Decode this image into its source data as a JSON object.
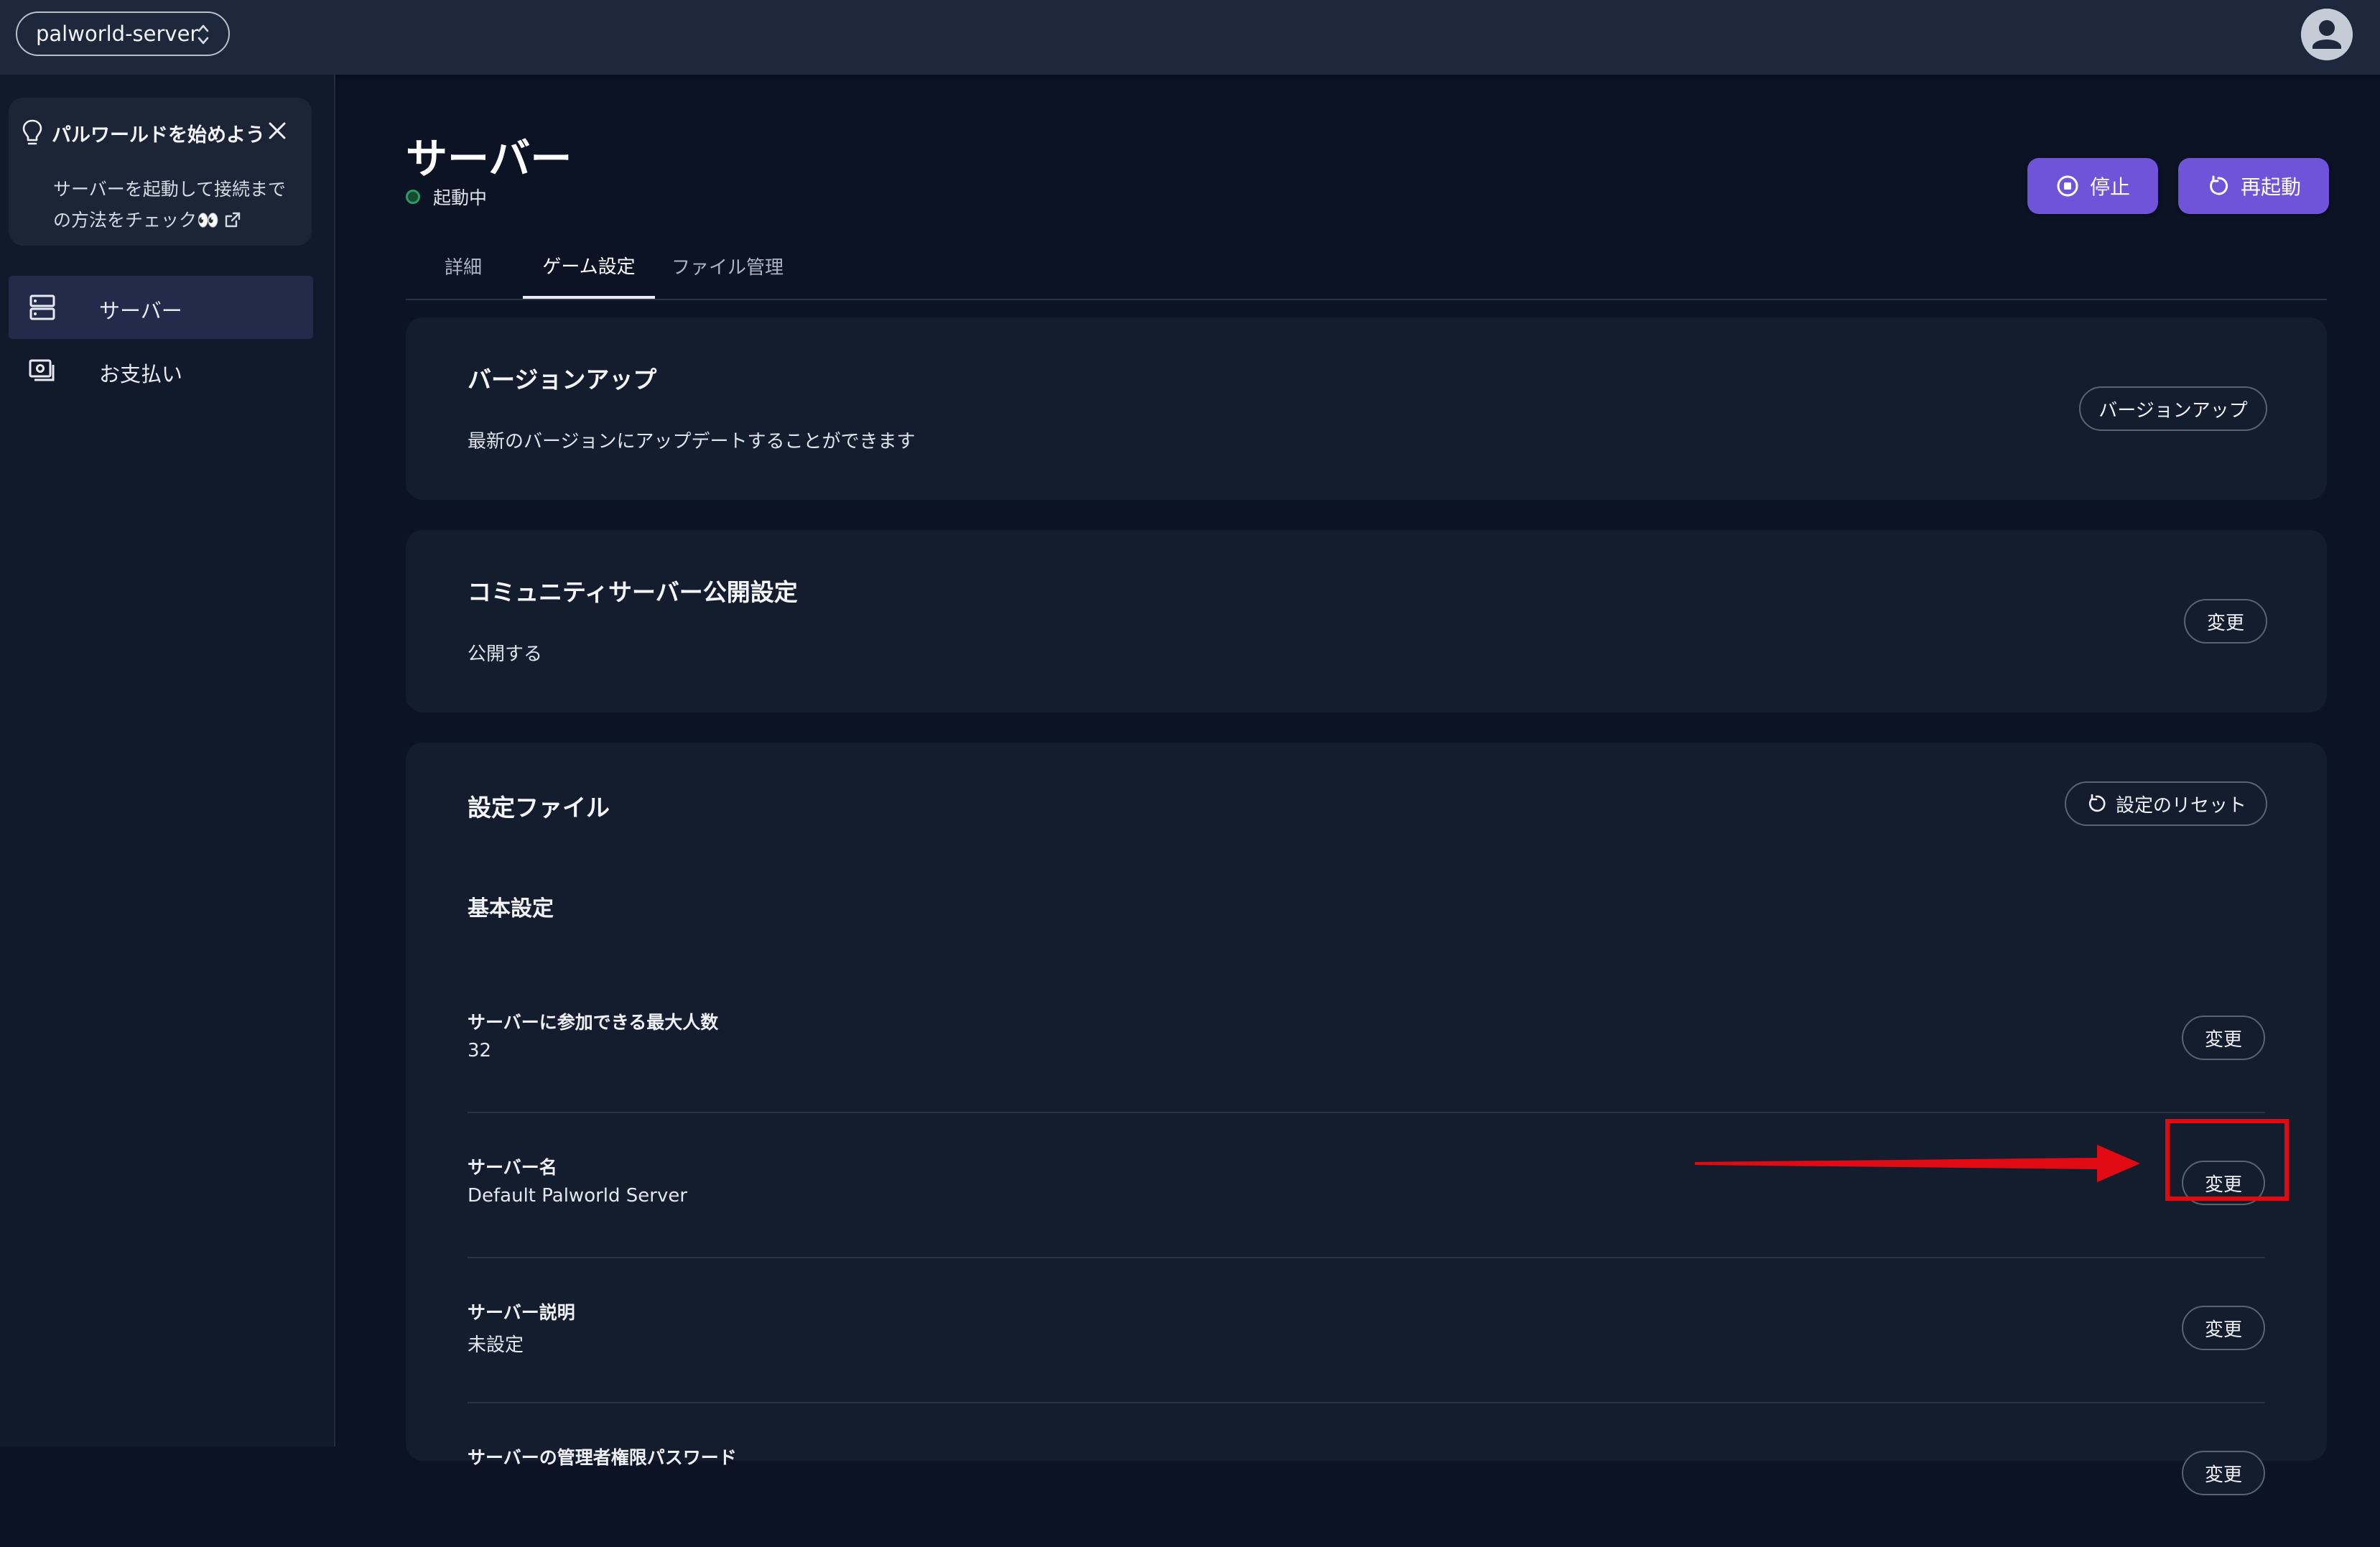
{
  "topbar": {
    "server_name": "palworld-server"
  },
  "sidebar": {
    "tip": {
      "title": "パルワールドを始めよう",
      "body_line1": "サーバーを起動して接続まで",
      "body_line2": "の方法をチェック👀"
    },
    "items": [
      {
        "label": "サーバー",
        "active": true
      },
      {
        "label": "お支払い",
        "active": false
      }
    ]
  },
  "main": {
    "title": "サーバー",
    "status": "起動中",
    "actions": {
      "stop": "停止",
      "restart": "再起動"
    },
    "tabs": [
      {
        "label": "詳細",
        "active": false
      },
      {
        "label": "ゲーム設定",
        "active": true
      },
      {
        "label": "ファイル管理",
        "active": false
      }
    ],
    "version_card": {
      "title": "バージョンアップ",
      "description": "最新のバージョンにアップデートすることができます",
      "button": "バージョンアップ"
    },
    "community_card": {
      "title": "コミュニティサーバー公開設定",
      "value": "公開する",
      "button": "変更"
    },
    "config_card": {
      "title": "設定ファイル",
      "reset_button": "設定のリセット",
      "section": "基本設定",
      "settings": [
        {
          "label": "サーバーに参加できる最大人数",
          "value": "32",
          "button": "変更"
        },
        {
          "label": "サーバー名",
          "value": "Default Palworld Server",
          "button": "変更"
        },
        {
          "label": "サーバー説明",
          "value": "未設定",
          "button": "変更"
        },
        {
          "label": "サーバーの管理者権限パスワード",
          "value": "",
          "button": "変更"
        }
      ]
    }
  },
  "colors": {
    "accent": "#6f54d9",
    "background": "#0b1325",
    "card": "#141d2e",
    "annotation": "#e00a12",
    "status_ok": "#2e9a62"
  }
}
